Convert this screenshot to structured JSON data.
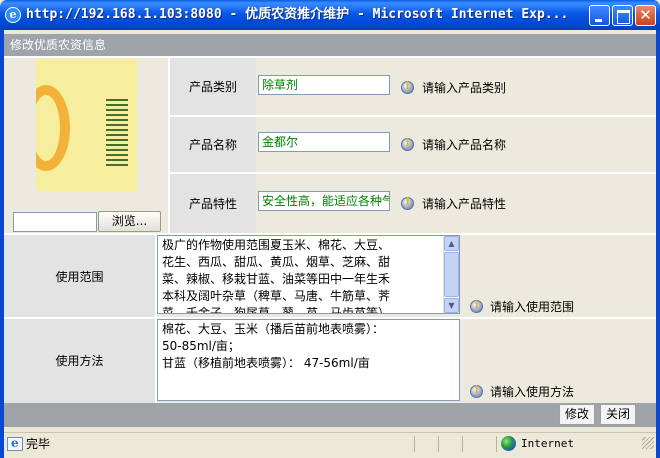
{
  "window": {
    "title": "http://192.168.1.103:8080 - 优质农资推介维护 - Microsoft Internet Exp..."
  },
  "page": {
    "header": "修改优质农资信息"
  },
  "image_panel": {
    "browse_label": "浏览...",
    "file_value": ""
  },
  "form": {
    "category": {
      "label": "产品类别",
      "value": "除草剂",
      "hint": "请输入产品类别"
    },
    "name": {
      "label": "产品名称",
      "value": "金都尔",
      "hint": "请输入产品名称"
    },
    "feature": {
      "label": "产品特性",
      "value": "安全性高，能适应各种气",
      "hint": "请输入产品特性"
    },
    "scope": {
      "label": "使用范围",
      "hint": "请输入使用范围",
      "lines": [
        "极广的作物使用范围夏玉米、棉花、大豆、",
        "花生、西瓜、甜瓜、黄瓜、烟草、芝麻、甜",
        "菜、辣椒、移栽甘蓝、油菜等田中一年生禾",
        "本科及阔叶杂草（稗草、马唐、牛筋草、荠",
        "菜、千金子、狗尾草、蓼、苋、马齿苋等）"
      ]
    },
    "usage": {
      "label": "使用方法",
      "hint": "请输入使用方法",
      "lines": [
        "棉花、大豆、玉米（播后苗前地表喷雾）：",
        "50-85ml/亩；",
        "甘蓝（移植前地表喷雾）： 47-56ml/亩"
      ]
    }
  },
  "footer": {
    "modify_label": "修改",
    "close_label": "关闭"
  },
  "status": {
    "text": "完毕",
    "zone": "Internet"
  },
  "colors": {
    "titlebar": "#0858e6",
    "header_bg": "#9fa4a9",
    "label_bg": "#e3e3e3",
    "value_bg": "#eceadf",
    "input_text": "#008000"
  }
}
